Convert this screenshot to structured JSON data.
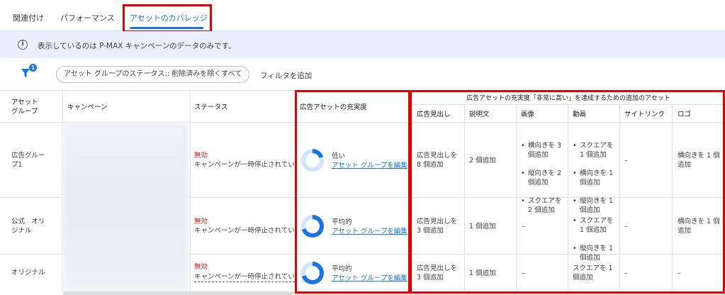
{
  "tabs": [
    {
      "label": "関連付け"
    },
    {
      "label": "パフォーマンス"
    },
    {
      "label": "アセットのカバレッジ",
      "active": true
    }
  ],
  "info": {
    "text": "表示しているのは P-MAX キャンペーンのデータのみです。",
    "icon": "info-icon"
  },
  "filter": {
    "badge": "1",
    "chip": "アセット グループのステータス:: 削除済みを除くすべて",
    "add": "フィルタを追加"
  },
  "headers": {
    "asset_group": "アセット\nグループ",
    "campaign": "キャンペーン",
    "status": "ステータス",
    "strength": "広告アセットの充実度",
    "extra_title": "広告アセットの充実度「非常に高い」を達成するための追加のアセット",
    "headline": "広告見出し",
    "description": "説明文",
    "image": "画像",
    "video": "動画",
    "sitelink": "サイトリンク",
    "logo": "ロゴ"
  },
  "rows": [
    {
      "group": "広告グルー\nプ1",
      "status_label": "無効",
      "status_detail": "キャンペーンが一時停止されていま",
      "strength_label": "低い",
      "strength_percent": 20,
      "edit_link": "アセット グループを編集",
      "headline": "広告見出しを\n8 個追加",
      "description": "2 個追加",
      "image": [
        "横向きを 3\n個追加",
        "縦向きを 2\n個追加",
        "スクエアを\n2 個追加"
      ],
      "video": [
        "スクエアを\n1 個追加",
        "横向きを 1\n個追加",
        "縦向きを 1\n個追加"
      ],
      "sitelink": "–",
      "logo": "横向きを 1 個\n追加"
    },
    {
      "group": "公式　オリ\nジナル",
      "status_label": "無効",
      "status_detail": "キャンペーンが一時停止されていま",
      "strength_label": "平均的",
      "strength_percent": 70,
      "edit_link": "アセット グループを編集",
      "headline": "広告見出しを\n3 個追加",
      "description": "1 個追加",
      "image": "–",
      "video": [
        "スクエアを\n1 個追加",
        "縦向きを 1\n個追加"
      ],
      "sitelink": "–",
      "logo": "横向きを 1 個\n追加"
    },
    {
      "group": "オリジナル",
      "status_label": "無効",
      "status_detail": "キャンペーンが一時停止されていま",
      "strength_label": "平均的",
      "strength_percent": 70,
      "edit_link": "アセット グループを編集",
      "headline": "広告見出しを\n3 個追加",
      "description": "1 個追加",
      "image": "–",
      "video": "スクエアを 1\n個追加",
      "sitelink": "–",
      "logo": "–"
    }
  ],
  "colors": {
    "accent": "#1a73e8",
    "ring_track": "#d2e3fc",
    "status_red": "#c5221f",
    "highlight_red": "#e00000",
    "info_bg": "#e8f0fe"
  }
}
